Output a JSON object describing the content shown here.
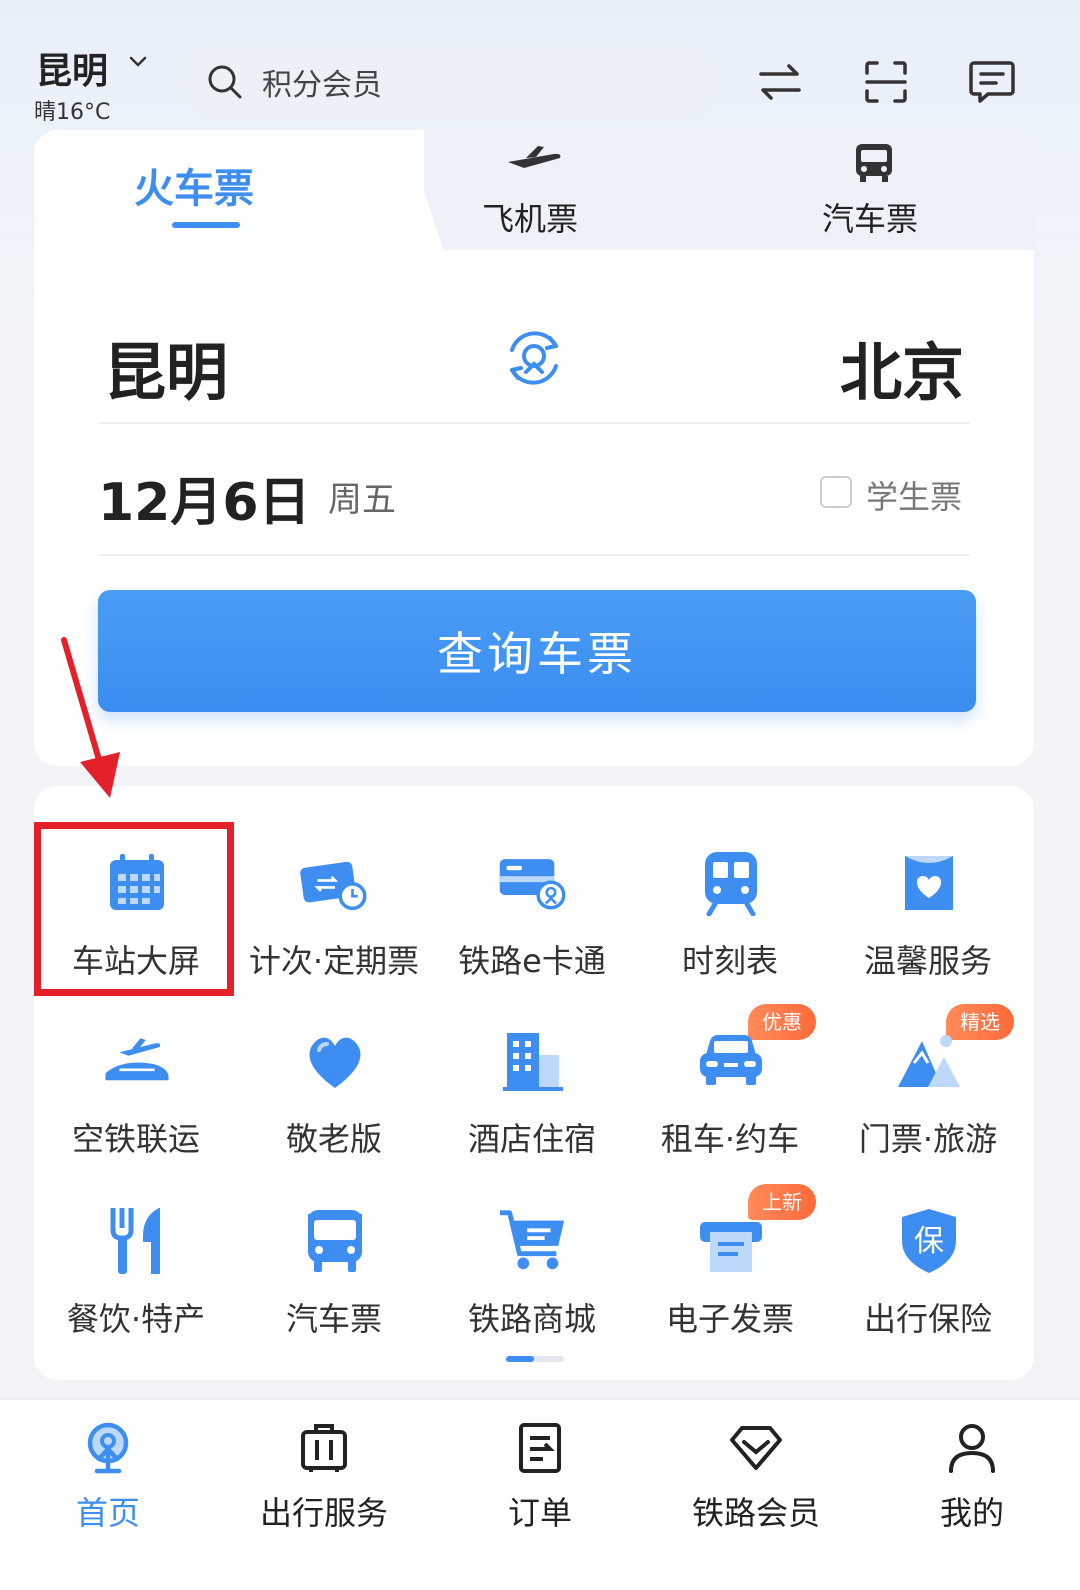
{
  "header": {
    "city": "昆明",
    "weather": "晴16°C",
    "search_placeholder": "积分会员"
  },
  "ticket_tabs": {
    "train": "火车票",
    "plane": "飞机票",
    "bus": "汽车票"
  },
  "search_form": {
    "from_city": "昆明",
    "to_city": "北京",
    "date": "12月6日",
    "weekday": "周五",
    "student_label": "学生票",
    "student_checked": false,
    "query_button": "查询车票"
  },
  "services": [
    {
      "label": "车站大屏",
      "icon": "calendar-icon",
      "badge": ""
    },
    {
      "label": "计次·定期票",
      "icon": "ticket-clock-icon",
      "badge": ""
    },
    {
      "label": "铁路e卡通",
      "icon": "rail-card-icon",
      "badge": ""
    },
    {
      "label": "时刻表",
      "icon": "train-front-icon",
      "badge": ""
    },
    {
      "label": "温馨服务",
      "icon": "heart-box-icon",
      "badge": ""
    },
    {
      "label": "空铁联运",
      "icon": "plane-train-icon",
      "badge": ""
    },
    {
      "label": "敬老版",
      "icon": "heart-icon",
      "badge": ""
    },
    {
      "label": "酒店住宿",
      "icon": "building-icon",
      "badge": ""
    },
    {
      "label": "租车·约车",
      "icon": "car-icon",
      "badge": "优惠"
    },
    {
      "label": "门票·旅游",
      "icon": "mountain-icon",
      "badge": "精选"
    },
    {
      "label": "餐饮·特产",
      "icon": "fork-knife-icon",
      "badge": ""
    },
    {
      "label": "汽车票",
      "icon": "bus-icon",
      "badge": ""
    },
    {
      "label": "铁路商城",
      "icon": "cart-icon",
      "badge": ""
    },
    {
      "label": "电子发票",
      "icon": "invoice-icon",
      "badge": "上新"
    },
    {
      "label": "出行保险",
      "icon": "shield-icon",
      "badge": ""
    }
  ],
  "services_extra": {
    "shield_char": "保"
  },
  "bottom_nav": {
    "home": "首页",
    "travel": "出行服务",
    "orders": "订单",
    "member": "铁路会员",
    "mine": "我的"
  },
  "colors": {
    "accent": "#3d8ef0",
    "highlight": "#e4202a",
    "badge": "#ff6a3a"
  }
}
